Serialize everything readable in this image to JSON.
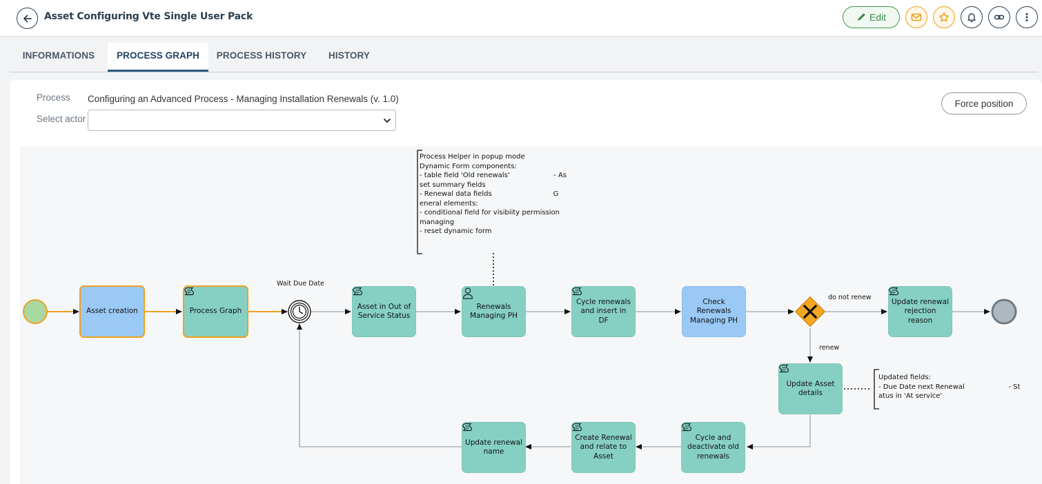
{
  "header": {
    "title": "Asset Configuring Vte Single User Pack",
    "edit_label": "Edit"
  },
  "tabs": [
    {
      "label": "INFORMATIONS"
    },
    {
      "label": "PROCESS GRAPH"
    },
    {
      "label": "PROCESS HISTORY"
    },
    {
      "label": "HISTORY"
    }
  ],
  "process": {
    "process_label": "Process",
    "process_value": "Configuring an Advanced Process - Managing Installation Renewals (v. 1.0)",
    "actor_label": "Select actor",
    "actor_value": "",
    "force_position_label": "Force position"
  },
  "graph": {
    "annotation_helper": "Process Helper in popup mode\nDynamic Form components:\n- table field 'Old renewals'                    - As\nset summary fields\n- Renewal data fields                            G\neneral elements:\n- conditional field for visibiity permission\nmanaging\n- reset dynamic form",
    "annotation_updated": "Updated fields:\n- Due Date next Renewal                    - St\natus in 'At service'",
    "timer_label": "Wait Due Date",
    "flow_do_not_renew": "do not renew",
    "flow_renew": "renew",
    "nodes": {
      "asset_creation": "Asset creation",
      "process_graph": "Process Graph",
      "asset_out_of_service": "Asset in Out of Service Status",
      "renewals_managing_ph": "Renewals Managing PH",
      "cycle_renewals_insert": "Cycle renewals and insert in DF",
      "check_renewals": "Check Renewals Managing PH",
      "update_rejection": "Update renewal rejection reason",
      "update_asset_details": "Update Asset details",
      "cycle_deactivate": "Cycle and deactivate old renewals",
      "create_renewal": "Create Renewal and relate to Asset",
      "update_renewal_name": "Update renewal name"
    }
  },
  "colors": {
    "task_green": "#86d0c3",
    "task_blue": "#9ac9f6",
    "active_orange": "#f0a020",
    "gateway": "#f5a623",
    "start_event": "#a8d9a0",
    "end_event": "#b0b8bf"
  }
}
